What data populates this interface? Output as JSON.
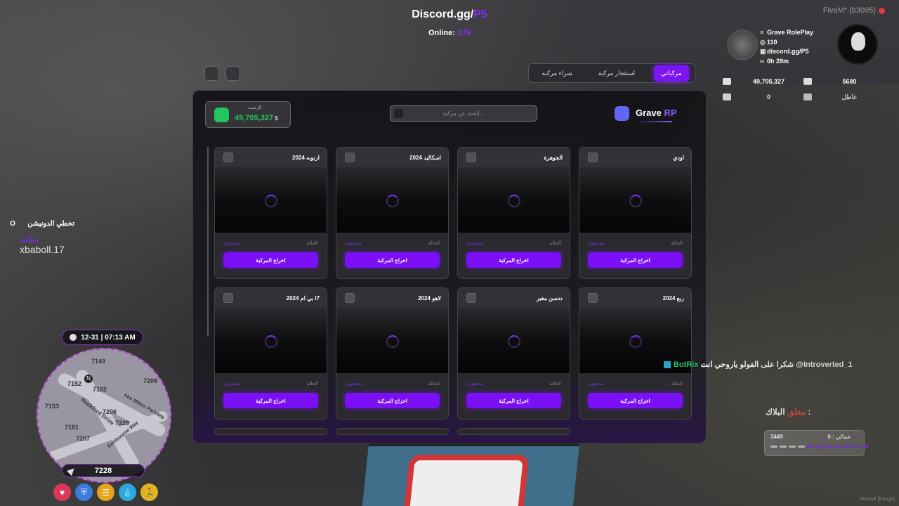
{
  "hud_top": {
    "discord_prefix": "Discord.gg/",
    "discord_suffix": "P5",
    "online_label": "Online:",
    "online_value": "176",
    "fivem_label": "FiveM* (b3095)"
  },
  "server_info": {
    "name": "Grave RolePlay",
    "id": "110",
    "discord": "discord.gg/P5",
    "time": "0h 28m"
  },
  "stats": {
    "bank": "49,705,327",
    "cash_id": "5680",
    "wallet": "0",
    "job": "عاطل"
  },
  "tabs": [
    {
      "label": "شراء مركبة",
      "active": false
    },
    {
      "label": "استئجار مركبة",
      "active": false
    },
    {
      "label": "مركباتي",
      "active": true
    }
  ],
  "panel": {
    "brand_prefix": "Grave",
    "brand_suffix": "RP",
    "search_placeholder": "ابحث عن مركبة...",
    "balance_label": "الرصيد",
    "balance_value": "49,705,327",
    "currency": "$"
  },
  "vehicles": [
    {
      "name": "اودي",
      "status_label": "الحالة",
      "status_value": "محجوزة",
      "action": "اخراج المركبة"
    },
    {
      "name": "الجوهرة",
      "status_label": "الحالة",
      "status_value": "محجوزة",
      "action": "اخراج المركبة"
    },
    {
      "name": "اسكاليد 2024",
      "status_label": "الحالة",
      "status_value": "محجوزة",
      "action": "اخراج المركبة"
    },
    {
      "name": "ارنوبه 2024",
      "status_label": "الحالة",
      "status_value": "محجوزة",
      "action": "اخراج المركبة"
    },
    {
      "name": "ربع 2024",
      "status_label": "الحالة",
      "status_value": "محجوزة",
      "action": "اخراج المركبة"
    },
    {
      "name": "ددسن مغبر",
      "status_label": "الحالة",
      "status_value": "محجوزة",
      "action": "اخراج المركبة"
    },
    {
      "name": "لاهو 2024",
      "status_label": "الحالة",
      "status_value": "محجوزة",
      "action": "اخراج المركبة"
    },
    {
      "name": "بي ام 2024 i7",
      "status_label": "الحالة",
      "status_value": "محجوزة",
      "action": "اخراج المركبة"
    }
  ],
  "left_hud": {
    "streamer_line": "تخطي الدونيشن",
    "streamer_key": "O",
    "talking_label": "يتكلم",
    "username": "xbaboll.17",
    "date_time": "12-31 | 07:13 AM",
    "compass": "N",
    "street_code": "7228",
    "map_labels": [
      "7149",
      "7152",
      "7182",
      "7153",
      "7206",
      "7181",
      "7229",
      "7207",
      "7208",
      "Rockford Drive",
      "Abe Milton Parkway",
      "Eastbourne Way"
    ]
  },
  "status_icons": [
    {
      "name": "health",
      "color": "#d9385a",
      "glyph": "♥"
    },
    {
      "name": "armor",
      "color": "#3b7bd9",
      "glyph": "⛨"
    },
    {
      "name": "hunger",
      "color": "#e6a31d",
      "glyph": "☰"
    },
    {
      "name": "thirst",
      "color": "#2fa6d9",
      "glyph": "💧"
    },
    {
      "name": "stamina",
      "color": "#e0b321",
      "glyph": "🏃"
    }
  ],
  "right_hud": {
    "chat_user": "@Introverted_1",
    "chat_text": "شكرا على الفولو ياروحي انت",
    "chat_bot": "BotRix",
    "block_label": "البلاك :",
    "block_value": "مغلق",
    "workers_label": "عمالي : 6",
    "workers_value": "3449",
    "workers_level": 0.6,
    "mode": "Normal [Range]"
  },
  "colors": {
    "accent": "#7b16f2",
    "money": "#22c55e",
    "danger": "#e04545"
  }
}
